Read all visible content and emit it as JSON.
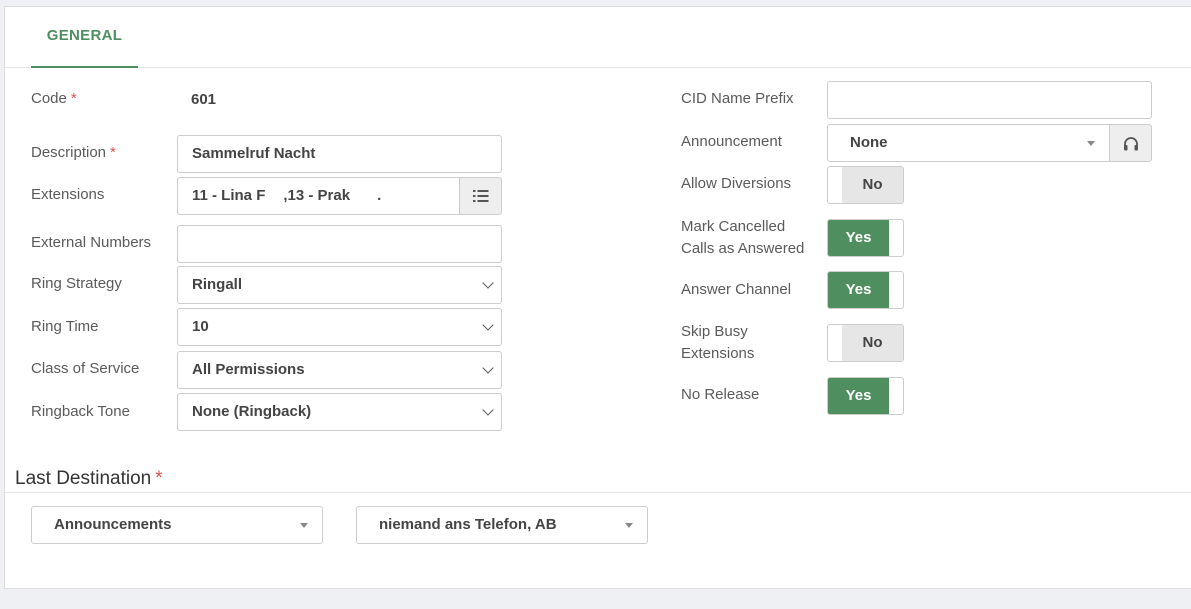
{
  "tabs": [
    {
      "label": "GENERAL"
    }
  ],
  "left": {
    "code": {
      "label": "Code",
      "value": "601"
    },
    "description": {
      "label": "Description",
      "value": "Sammelruf Nacht"
    },
    "extensions": {
      "label": "Extensions",
      "value": "11 - Lina F      ,13 - Prak         ."
    },
    "external_numbers": {
      "label": "External Numbers",
      "value": ""
    },
    "ring_strategy": {
      "label": "Ring Strategy",
      "value": "Ringall"
    },
    "ring_time": {
      "label": "Ring Time",
      "value": "10"
    },
    "class_of_service": {
      "label": "Class of Service",
      "value": "All Permissions"
    },
    "ringback_tone": {
      "label": "Ringback Tone",
      "value": "None (Ringback)"
    }
  },
  "right": {
    "cid_name_prefix": {
      "label": "CID Name Prefix",
      "value": ""
    },
    "announcement": {
      "label": "Announcement",
      "value": "None"
    },
    "allow_diversions": {
      "label": "Allow Diversions",
      "value": "No"
    },
    "mark_cancelled": {
      "label_line1": "Mark Cancelled",
      "label_line2": "Calls as Answered",
      "value": "Yes"
    },
    "answer_channel": {
      "label": "Answer Channel",
      "value": "Yes"
    },
    "skip_busy": {
      "label_line1": "Skip Busy",
      "label_line2": "Extensions",
      "value": "No"
    },
    "no_release": {
      "label": "No Release",
      "value": "Yes"
    }
  },
  "last_destination": {
    "title": "Last Destination",
    "type_value": "Announcements",
    "target_value": "niemand ans Telefon, AB"
  },
  "required_mark": "*",
  "colors": {
    "accent": "#4f8f5f",
    "required": "#d9534f"
  }
}
